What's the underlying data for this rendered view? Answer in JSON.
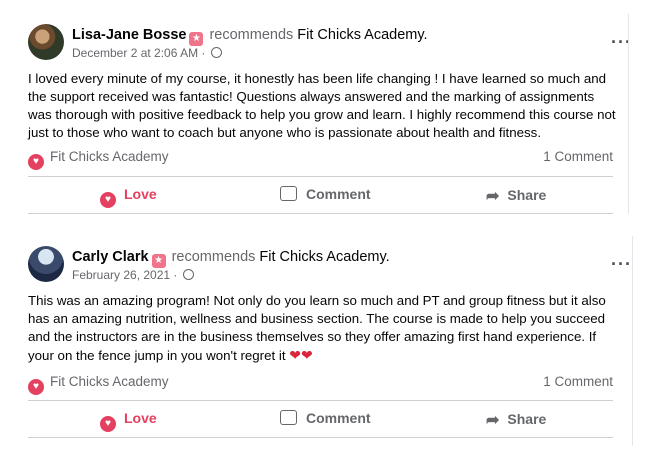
{
  "posts": [
    {
      "author": "Lisa-Jane Bosse",
      "recommends": "recommends",
      "page": "Fit Chicks Academy.",
      "date": "December 2 at 2:06 AM",
      "dot": "·",
      "text": "I loved every minute of my course, it honestly has been life changing ! I have learned so much and the support received was fantastic! Questions always answered and the marking of assignments was thorough with positive feedback to help you grow and learn. I highly recommend this course not just to those who want to coach but anyone who is passionate about health and fitness.",
      "reaction_by": "Fit Chicks Academy",
      "comment_count": "1 Comment",
      "actions": {
        "love": "Love",
        "comment": "Comment",
        "share": "Share"
      }
    },
    {
      "author": "Carly Clark",
      "recommends": "recommends",
      "page": "Fit Chicks Academy.",
      "date": "February 26, 2021",
      "dot": "·",
      "text": "This was an amazing program! Not only do you learn so much and PT and group fitness but it also has an amazing nutrition, wellness and business section. The course is made to help you succeed and the instructors are in the business themselves so they offer amazing first hand experience. If your on the fence jump in you won't regret it",
      "emoji": "❤❤",
      "reaction_by": "Fit Chicks Academy",
      "comment_count": "1 Comment",
      "actions": {
        "love": "Love",
        "comment": "Comment",
        "share": "Share"
      }
    }
  ],
  "icons": {
    "more": "···",
    "heart": "♥",
    "share": "➦"
  },
  "colors": {
    "love": "#e4405f",
    "muted": "#65676b"
  }
}
